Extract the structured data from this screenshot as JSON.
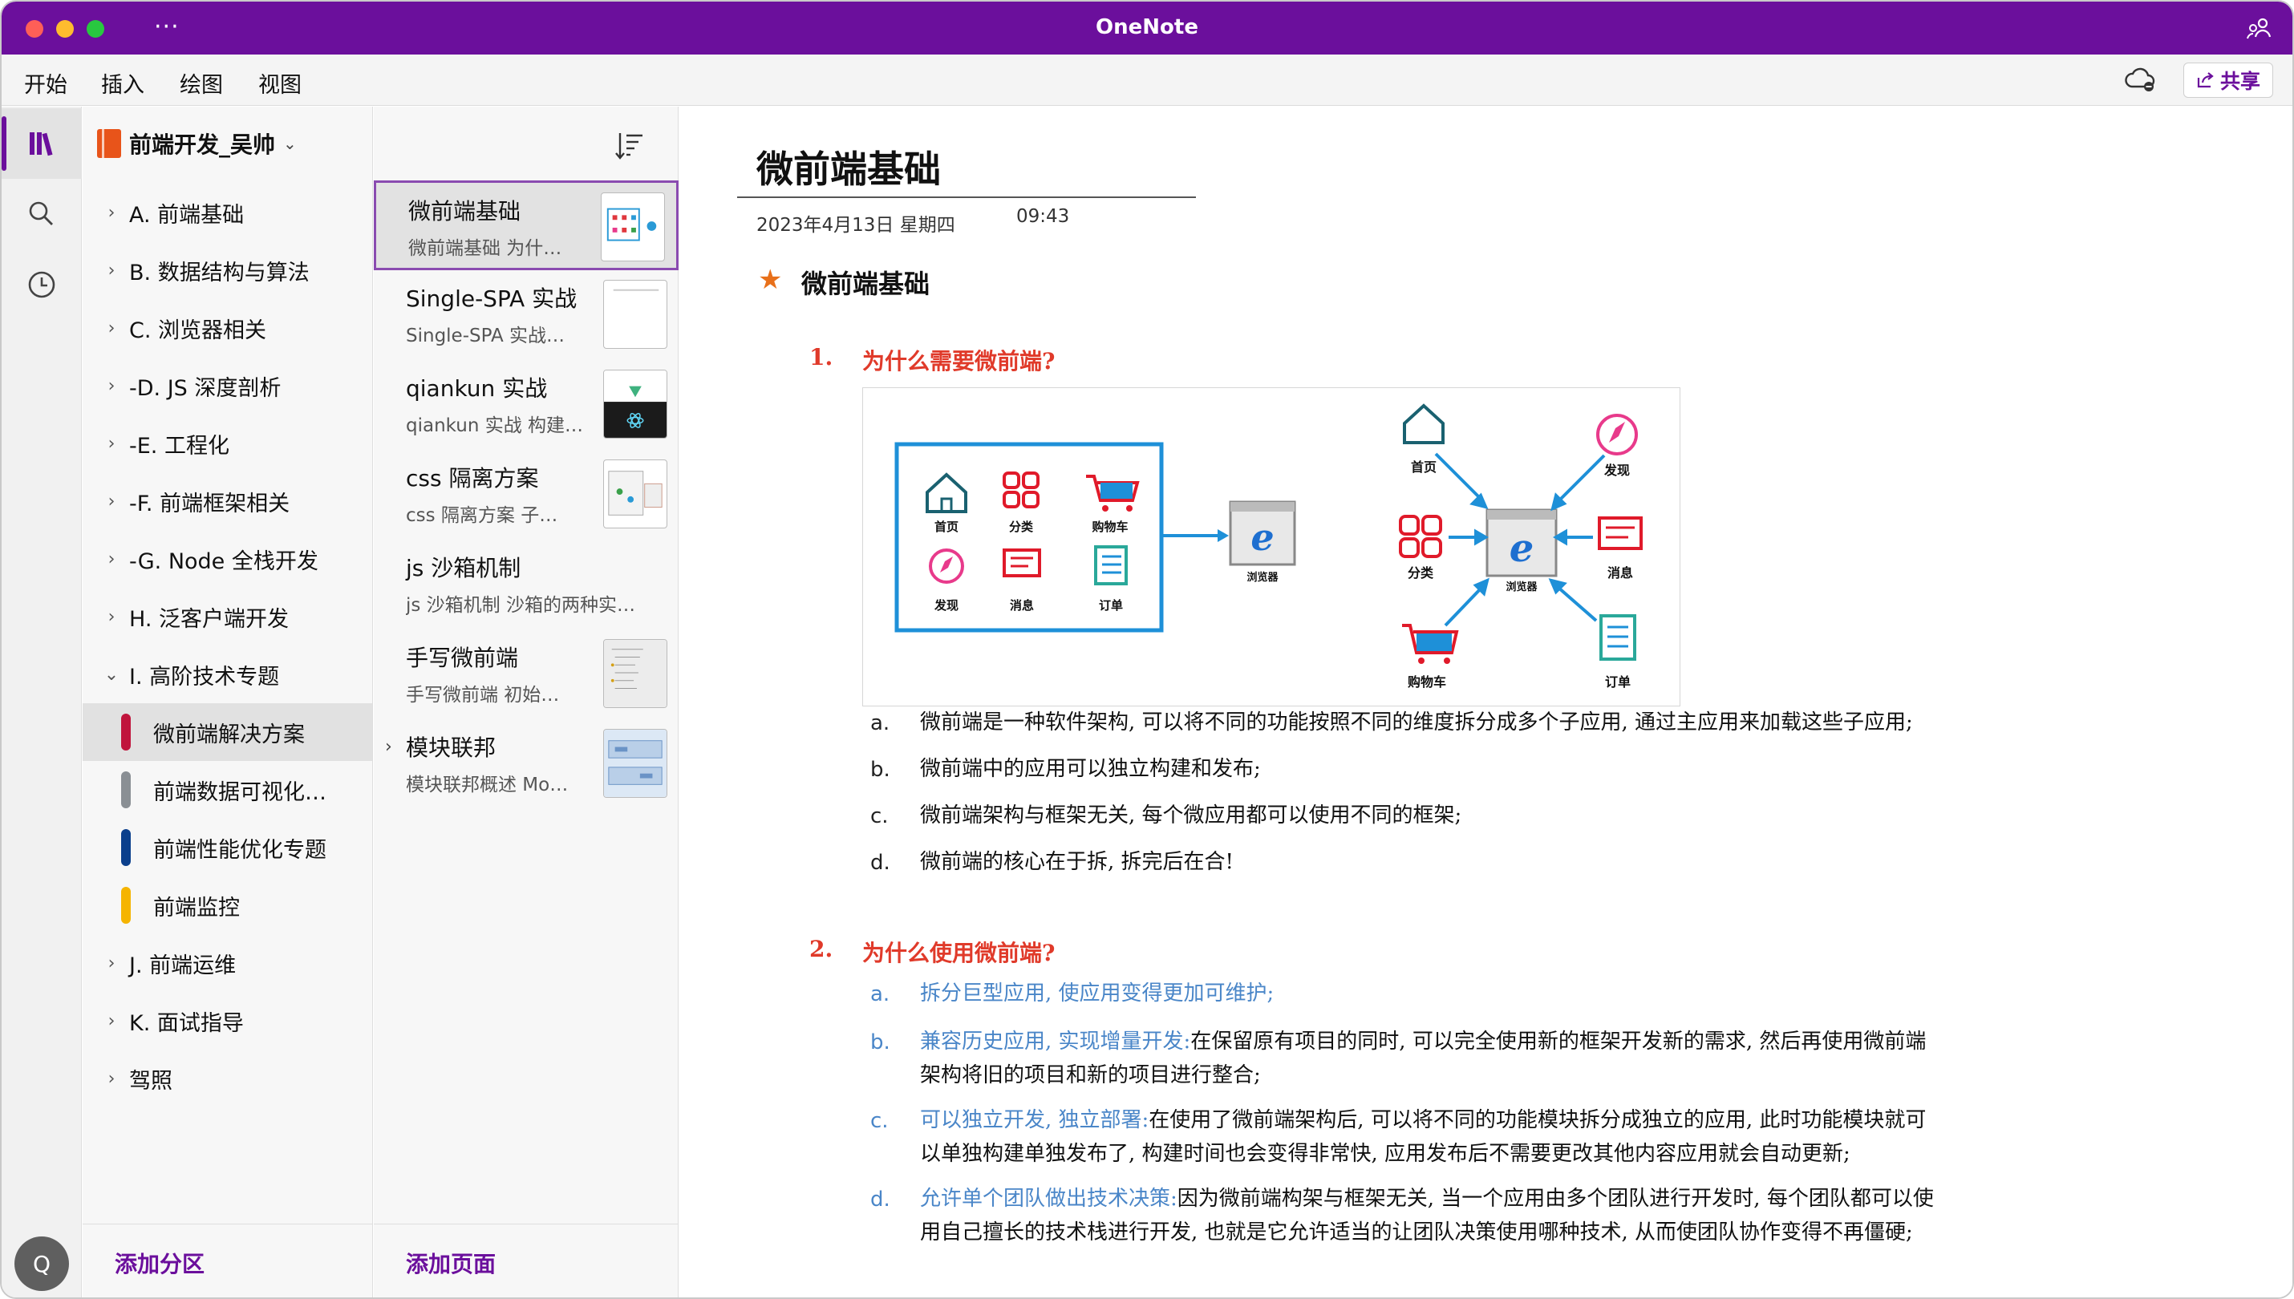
{
  "window": {
    "title": "OneNote",
    "more_label": "···"
  },
  "menu": {
    "items": [
      "开始",
      "插入",
      "绘图",
      "视图"
    ],
    "share_label": "共享"
  },
  "rail": {
    "avatar_letter": "Q"
  },
  "notebook": {
    "name": "前端开发_吴帅",
    "sections": [
      {
        "label": "A. 前端基础"
      },
      {
        "label": "B. 数据结构与算法"
      },
      {
        "label": "C. 浏览器相关"
      },
      {
        "label": "-D. JS 深度剖析"
      },
      {
        "label": "-E. 工程化"
      },
      {
        "label": "-F. 前端框架相关"
      },
      {
        "label": "-G. Node 全栈开发"
      },
      {
        "label": "H. 泛客户端开发"
      },
      {
        "label": "I. 高阶技术专题"
      }
    ],
    "sub_sections": [
      {
        "label": "微前端解决方案",
        "color": "#c0143c"
      },
      {
        "label": "前端数据可视化…",
        "color": "#8a8f94"
      },
      {
        "label": "前端性能优化专题",
        "color": "#0b3f8c"
      },
      {
        "label": "前端监控",
        "color": "#f5b400"
      }
    ],
    "sections_after": [
      {
        "label": "J. 前端运维"
      },
      {
        "label": "K. 面试指导"
      },
      {
        "label": "驾照"
      }
    ],
    "add_section_label": "添加分区"
  },
  "pages": {
    "items": [
      {
        "title": "微前端基础",
        "subtitle": "微前端基础  为什…"
      },
      {
        "title": "Single-SPA 实战",
        "subtitle": "Single-SPA 实战…"
      },
      {
        "title": "qiankun 实战",
        "subtitle": "qiankun 实战  构建…"
      },
      {
        "title": "css 隔离方案",
        "subtitle": "css 隔离方案  子…"
      },
      {
        "title": "js 沙箱机制",
        "subtitle": "js 沙箱机制  沙箱的两种实…"
      },
      {
        "title": "手写微前端",
        "subtitle": "手写微前端  初始…"
      },
      {
        "title": "模块联邦",
        "subtitle": "模块联邦概述  Mo…"
      }
    ],
    "add_page_label": "添加页面"
  },
  "page": {
    "title": "微前端基础",
    "date": "2023年4月13日 星期四",
    "time": "09:43",
    "heading": "微前端基础",
    "q1": {
      "num": "1.",
      "text": "为什么需要微前端?",
      "items": [
        {
          "mark": "a.",
          "text": "微前端是一种软件架构, 可以将不同的功能按照不同的维度拆分成多个子应用, 通过主应用来加载这些子应用;"
        },
        {
          "mark": "b.",
          "text": "微前端中的应用可以独立构建和发布;"
        },
        {
          "mark": "c.",
          "text": "微前端架构与框架无关, 每个微应用都可以使用不同的框架;"
        },
        {
          "mark": "d.",
          "text": "微前端的核心在于拆, 拆完后在合!"
        }
      ]
    },
    "diagram": {
      "left_labels": [
        "首页",
        "分类",
        "购物车",
        "发现",
        "消息",
        "订单"
      ],
      "browser_label": "浏览器",
      "right_labels": [
        "首页",
        "发现",
        "分类",
        "消息",
        "购物车",
        "订单"
      ],
      "browser_center_label": "浏览器"
    },
    "q2": {
      "num": "2.",
      "text": "为什么使用微前端?",
      "items": [
        {
          "mark": "a.",
          "lead": "拆分巨型应用, 使应用变得更加可维护;",
          "line1": "",
          "line2": ""
        },
        {
          "mark": "b.",
          "lead": "兼容历史应用, 实现增量开发:",
          "line1": "在保留原有项目的同时, 可以完全使用新的框架开发新的需求, 然后再使用微前端",
          "line2": "架构将旧的项目和新的项目进行整合;"
        },
        {
          "mark": "c.",
          "lead": "可以独立开发, 独立部署:",
          "line1": "在使用了微前端架构后, 可以将不同的功能模块拆分成独立的应用, 此时功能模块就可",
          "line2": "以单独构建单独发布了, 构建时间也会变得非常快, 应用发布后不需要更改其他内容应用就会自动更新;"
        },
        {
          "mark": "d.",
          "lead": "允许单个团队做出技术决策:",
          "line1": "因为微前端构架与框架无关, 当一个应用由多个团队进行开发时, 每个团队都可以使",
          "line2": "用自己擅长的技术栈进行开发, 也就是它允许适当的让团队决策使用哪种技术, 从而使团队协作变得不再僵硬;"
        }
      ]
    }
  }
}
